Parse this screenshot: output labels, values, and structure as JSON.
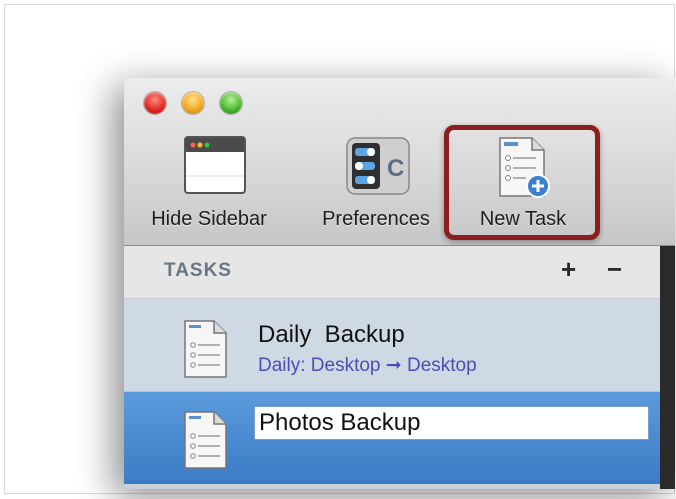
{
  "toolbar": {
    "hide_sidebar_label": "Hide Sidebar",
    "preferences_label": "Preferences",
    "new_task_label": "New Task"
  },
  "sidebar": {
    "header_title": "TASKS",
    "add_label": "+",
    "remove_label": "−",
    "tasks": [
      {
        "name": "Daily  Backup",
        "subtitle": "Daily: Desktop ➞ Desktop",
        "selected": false
      },
      {
        "name_value": "Photos Backup",
        "selected": true,
        "editing": true
      }
    ]
  },
  "icons": {
    "hide_sidebar": "window-icon",
    "preferences": "preferences-icon",
    "new_task": "new-task-document-icon",
    "task": "document-list-icon"
  },
  "colors": {
    "highlight_box": "#8e1d1d",
    "selected_row": "#3a7cc6",
    "subtitle_text": "#4a4fb8",
    "header_text": "#6a7683"
  }
}
